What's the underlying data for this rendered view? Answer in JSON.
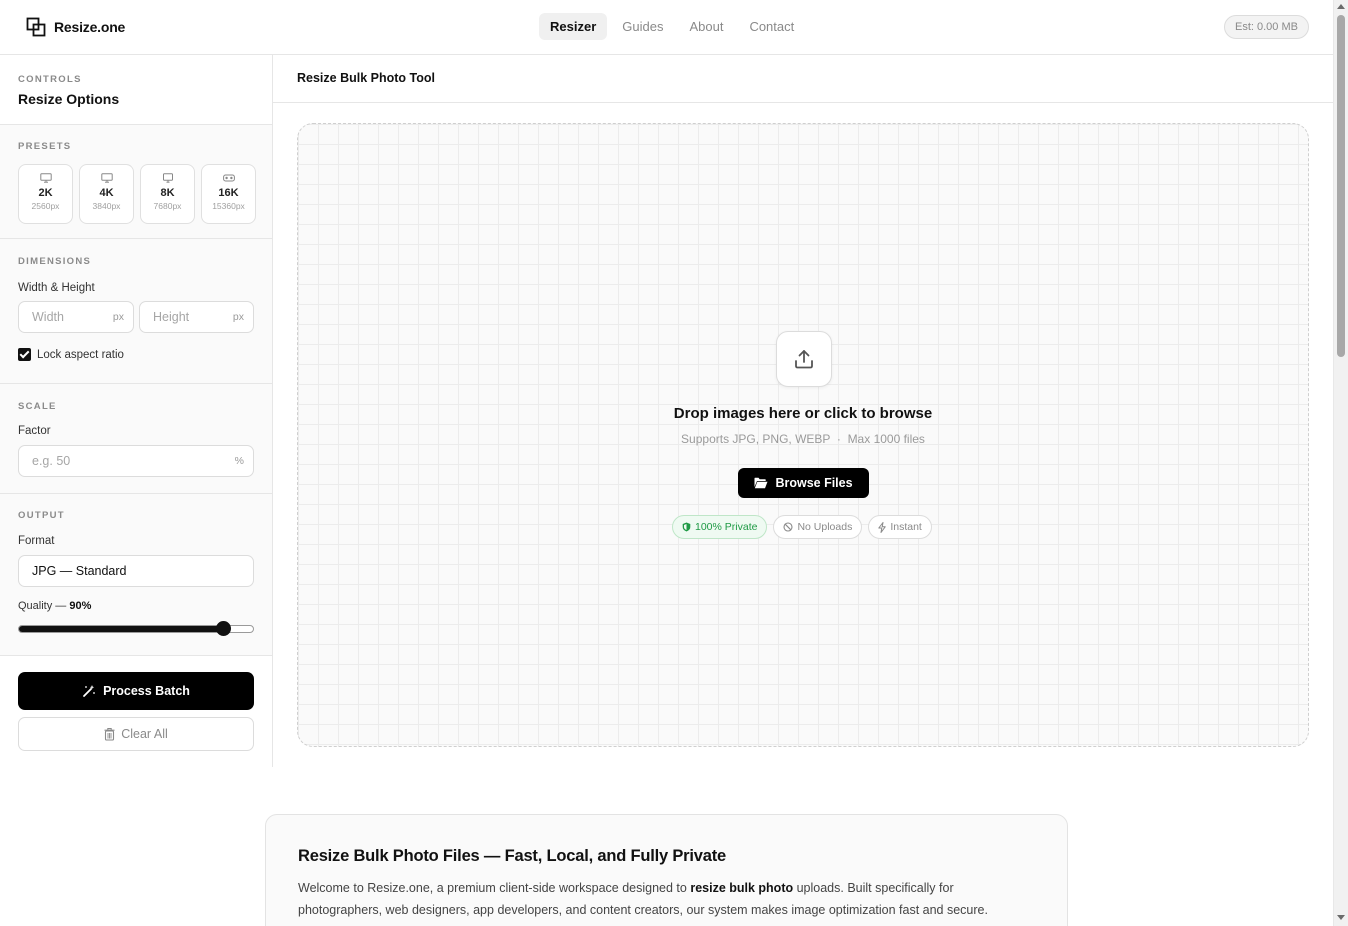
{
  "header": {
    "logo_text": "Resize.one",
    "nav": [
      {
        "label": "Resizer",
        "active": true
      },
      {
        "label": "Guides",
        "active": false
      },
      {
        "label": "About",
        "active": false
      },
      {
        "label": "Contact",
        "active": false
      }
    ],
    "estimate": "Est: 0.00 MB"
  },
  "sidebar": {
    "caption": "CONTROLS",
    "title": "Resize Options",
    "presets": {
      "caption": "PRESETS",
      "items": [
        {
          "name": "2K",
          "px": "2560px",
          "icon": "monitor-icon"
        },
        {
          "name": "4K",
          "px": "3840px",
          "icon": "monitor-icon"
        },
        {
          "name": "8K",
          "px": "7680px",
          "icon": "monitor-icon"
        },
        {
          "name": "16K",
          "px": "15360px",
          "icon": "vr-headset-icon"
        }
      ]
    },
    "dimensions": {
      "caption": "DIMENSIONS",
      "label": "Width & Height",
      "width_placeholder": "Width",
      "height_placeholder": "Height",
      "unit": "px",
      "lock_label": "Lock aspect ratio",
      "lock_checked": true
    },
    "scale": {
      "caption": "SCALE",
      "label": "Factor",
      "placeholder": "e.g. 50",
      "unit": "%"
    },
    "output": {
      "caption": "OUTPUT",
      "format_label": "Format",
      "format_value": "JPG — Standard",
      "quality_label": "Quality —",
      "quality_value": "90%",
      "quality_fraction": 0.9
    },
    "process_label": "Process Batch",
    "clear_label": "Clear All"
  },
  "main": {
    "title": "Resize Bulk Photo Tool",
    "drop_title": "Drop images here or click to browse",
    "drop_formats": "Supports JPG, PNG, WEBP",
    "drop_separator": "·",
    "drop_limit": "Max 1000 files",
    "browse_label": "Browse Files",
    "badges": [
      "100% Private",
      "No Uploads",
      "Instant"
    ]
  },
  "info": {
    "title": "Resize Bulk Photo Files — Fast, Local, and Fully Private",
    "body_pre": "Welcome to Resize.one, a premium client-side workspace designed to ",
    "body_bold": "resize bulk photo",
    "body_post": " uploads. Built specifically for photographers, web designers, app developers, and content creators, our system makes image optimization fast and secure."
  },
  "colors": {
    "accent": "#000000",
    "private_green": "#1f9a45"
  }
}
